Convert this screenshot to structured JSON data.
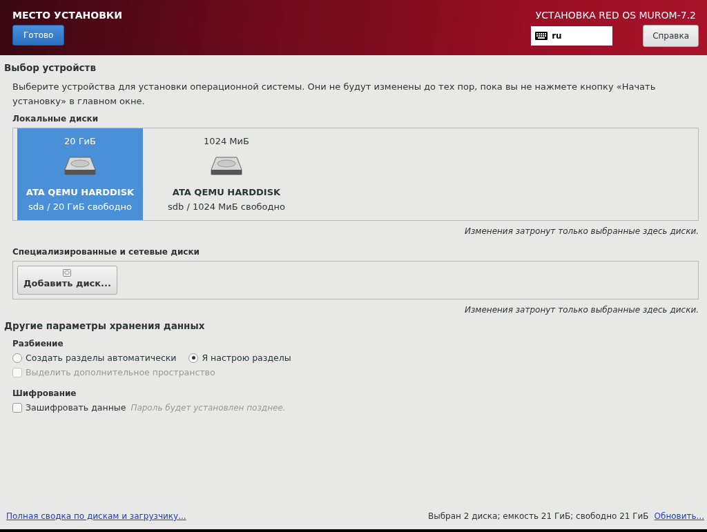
{
  "header": {
    "title": "МЕСТО УСТАНОВКИ",
    "done_button": "Готово",
    "product": "УСТАНОВКА RED OS MUROM-7.2",
    "keyboard_layout": "ru",
    "help_button": "Справка"
  },
  "device_selection": {
    "heading": "Выбор устройств",
    "description": "Выберите устройства для установки операционной системы. Они не будут изменены до тех пор, пока вы не нажмете кнопку «Начать установку» в главном окне.",
    "local_disks": {
      "label": "Локальные диски",
      "disks": [
        {
          "size": "20 ГиБ",
          "name": "ATA QEMU HARDDISK",
          "detail": "sda / 20 ГиБ свободно",
          "selected": true
        },
        {
          "size": "1024 МиБ",
          "name": "ATA QEMU HARDDISK",
          "detail": "sdb / 1024 МиБ свободно",
          "selected": false
        }
      ],
      "note": "Изменения затронут только выбранные здесь диски."
    },
    "specialized_disks": {
      "label": "Специализированные и сетевые диски",
      "add_button": "Добавить диск...",
      "note": "Изменения затронут только выбранные здесь диски."
    }
  },
  "other_storage": {
    "heading": "Другие параметры хранения данных",
    "partitioning": {
      "label": "Разбиение",
      "options": [
        {
          "label": "Создать разделы автоматически",
          "selected": false
        },
        {
          "label": "Я настрою разделы",
          "selected": true
        }
      ],
      "reclaim": {
        "label": "Выделить дополнительное пространство",
        "checked": false,
        "disabled": true
      }
    },
    "encryption": {
      "label": "Шифрование",
      "checkbox": {
        "label": "Зашифровать данные",
        "checked": false,
        "disabled": false
      },
      "hint": "Пароль будет установлен позднее."
    }
  },
  "footer": {
    "summary_link": "Полная сводка по дискам и загрузчику...",
    "status": "Выбран 2 диска; емкость 21 ГиБ; свободно 21 ГиБ",
    "refresh_link": "Обновить..."
  }
}
